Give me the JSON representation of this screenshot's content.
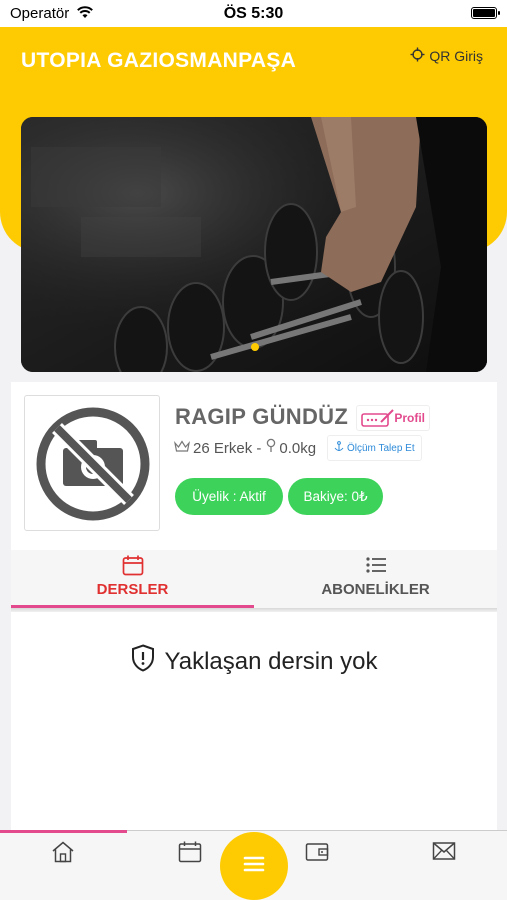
{
  "status_bar": {
    "carrier": "Operatör",
    "time": "ÖS 5:30"
  },
  "header": {
    "title": "UTOPIA GAZIOSMANPAŞA",
    "qr_label": "QR Giriş"
  },
  "banner": {
    "image": "dumbbell-rack-photo",
    "active_slide": 1
  },
  "profile": {
    "name": "RAGIP GÜNDÜZ",
    "profile_button": "Profil",
    "age_gender": "26 Erkek -",
    "weight": "0.0kg",
    "measure_request": "Ölçüm Talep Et",
    "membership": "Üyelik : Aktif",
    "balance": "Bakiye: 0₺"
  },
  "tabs": [
    {
      "label": "DERSLER",
      "icon": "calendar-icon",
      "active": true
    },
    {
      "label": "ABONELİKLER",
      "icon": "list-icon",
      "active": false
    }
  ],
  "empty_state": "Yaklaşan dersin yok",
  "bottom_nav": [
    {
      "icon": "home-icon",
      "active": true
    },
    {
      "icon": "calendar-icon",
      "active": false
    },
    {
      "icon": "menu-icon",
      "active": false
    },
    {
      "icon": "wallet-icon",
      "active": false
    },
    {
      "icon": "mail-icon",
      "active": false
    }
  ],
  "colors": {
    "accent": "#fecb02",
    "pink": "#e24a8d",
    "green": "#3dd35a",
    "red": "#e03030",
    "blue": "#2e8bd9"
  }
}
